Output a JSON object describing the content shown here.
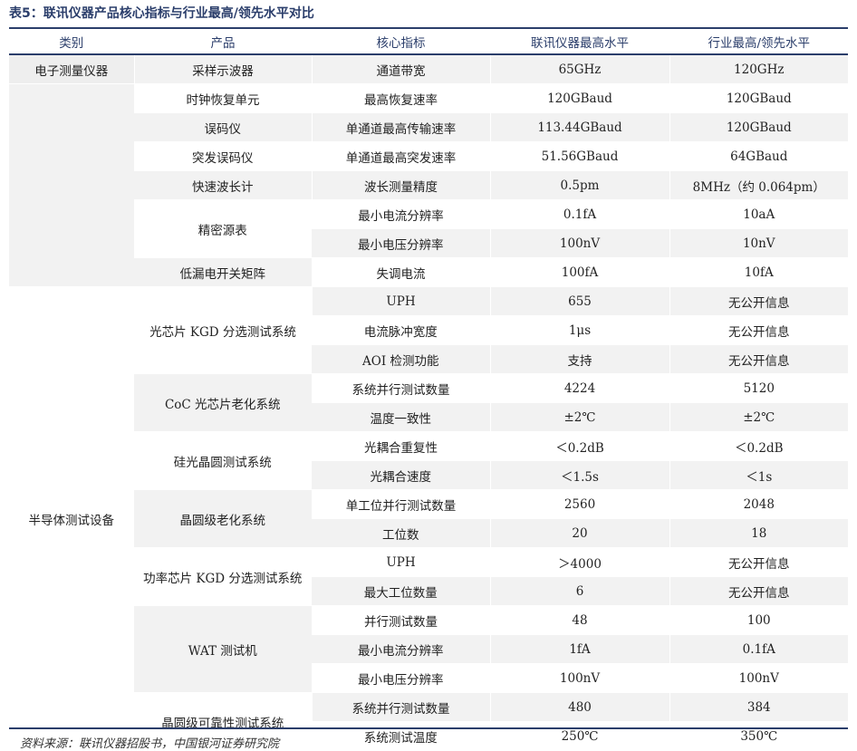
{
  "caption": "表5：联讯仪器产品核心指标与行业最高/领先水平对比",
  "headers": [
    "类别",
    "产品",
    "核心指标",
    "联讯仪器最高水平",
    "行业最高/领先水平"
  ],
  "categories": {
    "electronic": "电子测量仪器",
    "semiconductor": "半导体测试设备"
  },
  "products": {
    "p1": "采样示波器",
    "p2": "时钟恢复单元",
    "p3": "误码仪",
    "p4": "突发误码仪",
    "p5": "快速波长计",
    "p6": "精密源表",
    "p7": "低漏电开关矩阵",
    "p8": "光芯片 KGD 分选测试系统",
    "p9": "CoC 光芯片老化系统",
    "p10": "硅光晶圆测试系统",
    "p11": "晶圆级老化系统",
    "p12": "功率芯片 KGD 分选测试系统",
    "p13": "WAT 测试机",
    "p14": "晶圆级可靠性测试系统"
  },
  "rows": [
    {
      "metric": "通道带宽",
      "ours": "65GHz",
      "industry": "120GHz"
    },
    {
      "metric": "最高恢复速率",
      "ours": "120GBaud",
      "industry": "120GBaud"
    },
    {
      "metric": "单通道最高传输速率",
      "ours": "113.44GBaud",
      "industry": "120GBaud"
    },
    {
      "metric": "单通道最高突发速率",
      "ours": "51.56GBaud",
      "industry": "64GBaud"
    },
    {
      "metric": "波长测量精度",
      "ours": "0.5pm",
      "industry": "8MHz（约 0.064pm）"
    },
    {
      "metric": "最小电流分辨率",
      "ours": "0.1fA",
      "industry": "10aA"
    },
    {
      "metric": "最小电压分辨率",
      "ours": "100nV",
      "industry": "10nV"
    },
    {
      "metric": "失调电流",
      "ours": "100fA",
      "industry": "10fA"
    },
    {
      "metric": "UPH",
      "ours": "655",
      "industry": "无公开信息"
    },
    {
      "metric": "电流脉冲宽度",
      "ours": "1μs",
      "industry": "无公开信息"
    },
    {
      "metric": "AOI 检测功能",
      "ours": "支持",
      "industry": "无公开信息"
    },
    {
      "metric": "系统并行测试数量",
      "ours": "4224",
      "industry": "5120"
    },
    {
      "metric": "温度一致性",
      "ours": "±2℃",
      "industry": "±2℃"
    },
    {
      "metric": "光耦合重复性",
      "ours": "＜0.2dB",
      "industry": "＜0.2dB"
    },
    {
      "metric": "光耦合速度",
      "ours": "＜1.5s",
      "industry": "＜1s"
    },
    {
      "metric": "单工位并行测试数量",
      "ours": "2560",
      "industry": "2048"
    },
    {
      "metric": "工位数",
      "ours": "20",
      "industry": "18"
    },
    {
      "metric": "UPH",
      "ours": "＞4000",
      "industry": "无公开信息"
    },
    {
      "metric": "最大工位数量",
      "ours": "6",
      "industry": "无公开信息"
    },
    {
      "metric": "并行测试数量",
      "ours": "48",
      "industry": "100"
    },
    {
      "metric": "最小电流分辨率",
      "ours": "1fA",
      "industry": "0.1fA"
    },
    {
      "metric": "最小电压分辨率",
      "ours": "100nV",
      "industry": "100nV"
    },
    {
      "metric": "系统并行测试数量",
      "ours": "480",
      "industry": "384"
    },
    {
      "metric": "系统测试温度",
      "ours": "250℃",
      "industry": "350℃"
    }
  ],
  "source": "资料来源：联讯仪器招股书，中国银河证券研究院"
}
